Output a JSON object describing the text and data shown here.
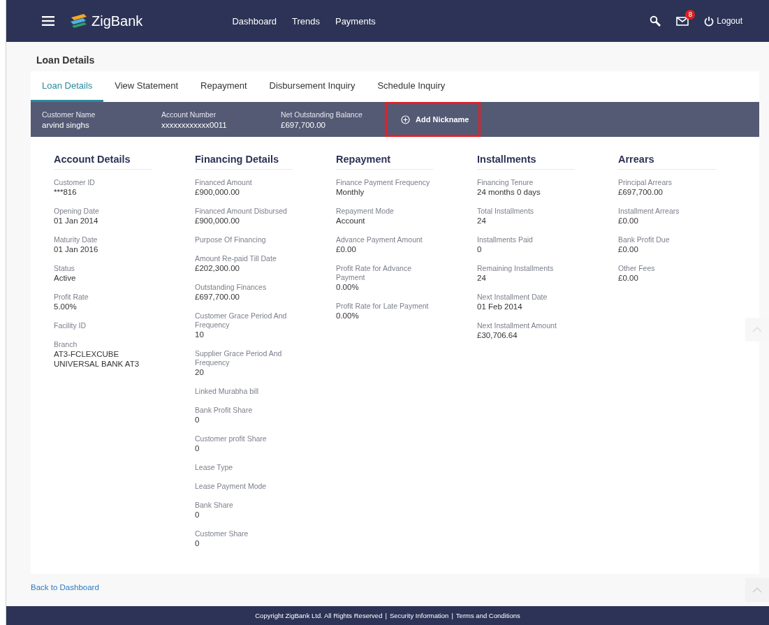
{
  "header": {
    "brand": "ZigBank",
    "nav": [
      "Dashboard",
      "Trends",
      "Payments"
    ],
    "mail_count": "8",
    "logout": "Logout"
  },
  "page_title": "Loan Details",
  "tabs": [
    {
      "label": "Loan Details",
      "selected": true
    },
    {
      "label": "View Statement",
      "selected": false
    },
    {
      "label": "Repayment",
      "selected": false
    },
    {
      "label": "Disbursement Inquiry",
      "selected": false
    },
    {
      "label": "Schedule Inquiry",
      "selected": false
    }
  ],
  "summary": [
    {
      "label": "Customer Name",
      "value": "arvind singhs"
    },
    {
      "label": "Account Number",
      "value": "xxxxxxxxxxxx0011"
    },
    {
      "label": "Net Outstanding Balance",
      "value": "£697,700.00"
    }
  ],
  "add_nickname": {
    "label": "Add Nickname",
    "highlighted": true
  },
  "sections": [
    {
      "title": "Account Details",
      "fields": [
        {
          "label": "Customer ID",
          "value": "***816"
        },
        {
          "label": "Opening Date",
          "value": "01 Jan 2014"
        },
        {
          "label": "Maturity Date",
          "value": "01 Jan 2016"
        },
        {
          "label": "Status",
          "value": "Active"
        },
        {
          "label": "Profit Rate",
          "value": "5.00%"
        },
        {
          "label": "Facility ID"
        },
        {
          "label": "Branch",
          "value": "AT3-FCLEXCUBE UNIVERSAL BANK AT3"
        }
      ]
    },
    {
      "title": "Financing Details",
      "fields": [
        {
          "label": "Financed Amount",
          "value": "£900,000.00"
        },
        {
          "label": "Financed Amount Disbursed",
          "value": "£900,000.00"
        },
        {
          "label": "Purpose Of Financing"
        },
        {
          "label": "Amount Re-paid Till Date",
          "value": "£202,300.00"
        },
        {
          "label": "Outstanding Finances",
          "value": "£697,700.00"
        },
        {
          "label": "Customer Grace Period And Frequency",
          "value": "10"
        },
        {
          "label": "Supplier Grace Period And Frequency",
          "value": "20"
        },
        {
          "label": "Linked Murabha bill"
        },
        {
          "label": "Bank Profit Share",
          "value": "0"
        },
        {
          "label": "Customer profit Share",
          "value": "0"
        },
        {
          "label": "Lease Type"
        },
        {
          "label": "Lease Payment Mode"
        },
        {
          "label": "Bank Share",
          "value": "0"
        },
        {
          "label": "Customer Share",
          "value": "0"
        }
      ]
    },
    {
      "title": "Repayment",
      "fields": [
        {
          "label": "Finance Payment Frequency",
          "value": "Monthly"
        },
        {
          "label": "Repayment Mode",
          "value": "Account"
        },
        {
          "label": "Advance Payment Amount",
          "value": "£0.00"
        },
        {
          "label": "Profit Rate for Advance Payment",
          "value": "0.00%"
        },
        {
          "label": "Profit Rate for Late Payment",
          "value": "0.00%"
        }
      ]
    },
    {
      "title": "Installments",
      "fields": [
        {
          "label": "Financing Tenure",
          "value": "24 months 0 days"
        },
        {
          "label": "Total Installments",
          "value": "24"
        },
        {
          "label": "Installments Paid",
          "value": "0"
        },
        {
          "label": "Remaining Installments",
          "value": "24"
        },
        {
          "label": "Next Installment Date",
          "value": "01 Feb 2014"
        },
        {
          "label": "Next Installment Amount",
          "value": "£30,706.64"
        }
      ]
    },
    {
      "title": "Arrears",
      "fields": [
        {
          "label": "Principal Arrears",
          "value": "£697,700.00"
        },
        {
          "label": "Installment Arrears",
          "value": "£0.00"
        },
        {
          "label": "Bank Profit Due",
          "value": "£0.00"
        },
        {
          "label": "Other Fees",
          "value": "£0.00"
        }
      ]
    }
  ],
  "back_link": "Back to Dashboard",
  "footer": {
    "copyright": "Copyright ZigBank Ltd. All Rights Reserved",
    "separator": "|",
    "links": [
      "Security Information",
      "Terms and Conditions"
    ]
  }
}
